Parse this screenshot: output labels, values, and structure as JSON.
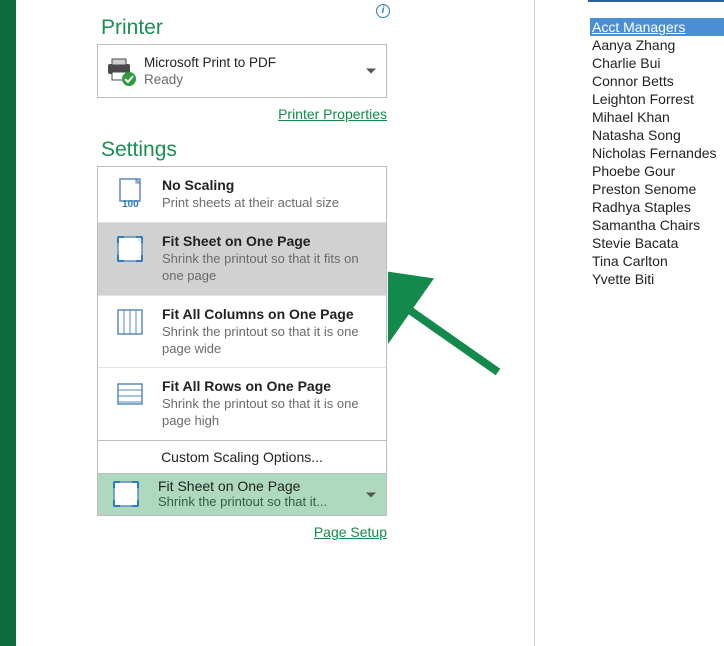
{
  "printer": {
    "section": "Printer",
    "name": "Microsoft Print to PDF",
    "status": "Ready",
    "propertiesLink": "Printer Properties"
  },
  "settings": {
    "section": "Settings",
    "options": [
      {
        "title": "No Scaling",
        "desc": "Print sheets at their actual size"
      },
      {
        "title": "Fit Sheet on One Page",
        "desc": "Shrink the printout so that it fits on one page"
      },
      {
        "title": "Fit All Columns on One Page",
        "desc": "Shrink the printout so that it is one page wide"
      },
      {
        "title": "Fit All Rows on One Page",
        "desc": "Shrink the printout so that it is one page high"
      }
    ],
    "customLabel": "Custom Scaling Options...",
    "selected": {
      "title": "Fit Sheet on One Page",
      "desc": "Shrink the printout so that it..."
    },
    "pageSetupLink": "Page Setup"
  },
  "preview": {
    "header": "Acct Managers",
    "rows": [
      "Aanya Zhang",
      "Charlie Bui",
      "Connor Betts",
      "Leighton Forrest",
      "Mihael Khan",
      "Natasha Song",
      "Nicholas Fernandes",
      "Phoebe Gour",
      "Preston Senome",
      "Radhya Staples",
      "Samantha Chairs",
      "Stevie Bacata",
      "Tina Carlton",
      "Yvette Biti"
    ]
  }
}
